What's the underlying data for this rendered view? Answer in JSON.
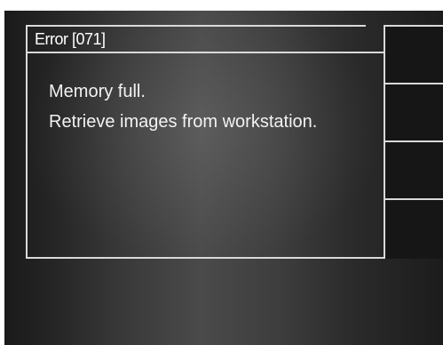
{
  "dialog": {
    "title": "Error [071]",
    "message_line1": "Memory full.",
    "message_line2": "Retrieve images from workstation."
  },
  "side_buttons": [
    "",
    "",
    "",
    ""
  ]
}
